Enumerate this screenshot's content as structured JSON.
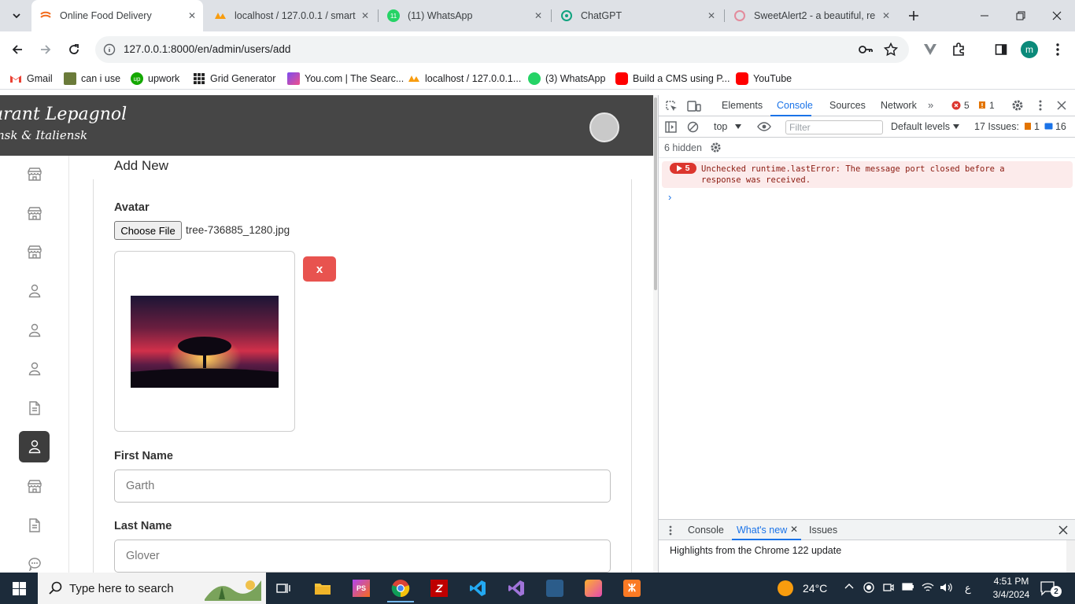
{
  "browser": {
    "tabs": [
      {
        "title": "Online Food Delivery",
        "active": true
      },
      {
        "title": "localhost / 127.0.0.1 / smart",
        "active": false
      },
      {
        "title": "(11) WhatsApp",
        "active": false
      },
      {
        "title": "ChatGPT",
        "active": false
      },
      {
        "title": "SweetAlert2 - a beautiful, re",
        "active": false
      }
    ],
    "url": "127.0.0.1:8000/en/admin/users/add",
    "profile_initial": "m",
    "bookmarks": [
      {
        "label": "Gmail",
        "icon": "gmail-icon"
      },
      {
        "label": "can i use",
        "icon": "caniuse-icon"
      },
      {
        "label": "upwork",
        "icon": "upwork-icon"
      },
      {
        "label": "Grid Generator",
        "icon": "grid-icon"
      },
      {
        "label": "You.com | The Searc...",
        "icon": "youcom-icon"
      },
      {
        "label": "localhost / 127.0.0.1...",
        "icon": "phpmyadmin-icon"
      },
      {
        "label": "(3) WhatsApp",
        "icon": "whatsapp-icon"
      },
      {
        "label": "Build a CMS using P...",
        "icon": "youtube-icon"
      },
      {
        "label": "YouTube",
        "icon": "youtube-icon"
      }
    ]
  },
  "app": {
    "brand_line1": "urant Lepagnol",
    "brand_line2": "nsk & Italiensk",
    "form": {
      "title": "Add New",
      "avatar_label": "Avatar",
      "choose_file_label": "Choose File",
      "file_name": "tree-736885_1280.jpg",
      "remove_label": "x",
      "first_name_label": "First Name",
      "first_name_value": "Garth",
      "last_name_label": "Last Name",
      "last_name_value": "Glover"
    },
    "sidebar_icons": [
      "store-icon",
      "store-icon",
      "store-icon",
      "user-icon",
      "user-icon",
      "user-icon",
      "document-icon",
      "user-icon",
      "store-icon",
      "document-icon",
      "chat-icon"
    ],
    "sidebar_active_index": 7
  },
  "devtools": {
    "tabs": [
      "Elements",
      "Console",
      "Sources",
      "Network"
    ],
    "active_tab": "Console",
    "error_count": "5",
    "warning_count": "1",
    "context": "top",
    "filter_placeholder": "Filter",
    "levels": "Default levels",
    "issues_label": "17 Issues:",
    "issues_warn": "1",
    "issues_info": "16",
    "hidden_label": "6 hidden",
    "error_repeat": "5",
    "error_message": "Unchecked runtime.lastError: The message port closed before a response was received.",
    "drawer_tabs": [
      "Console",
      "What's new",
      "Issues"
    ],
    "drawer_active": "What's new",
    "drawer_text": "Highlights from the Chrome 122 update"
  },
  "taskbar": {
    "search_placeholder": "Type here to search",
    "temperature": "24°C",
    "time": "4:51 PM",
    "date": "3/4/2024",
    "notification_count": "2",
    "lang": "ع"
  }
}
